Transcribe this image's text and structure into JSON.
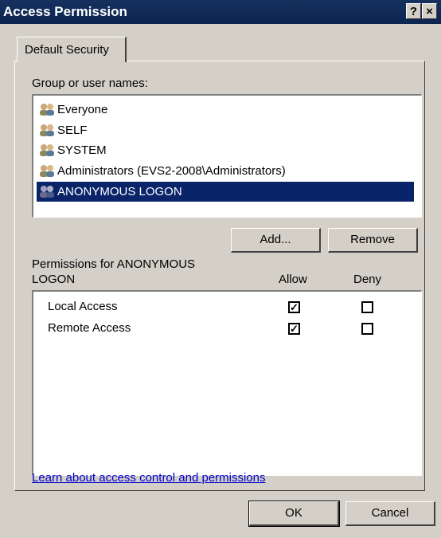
{
  "window": {
    "title": "Access Permission",
    "help_label": "?",
    "close_label": "×"
  },
  "tab": {
    "label": "Default Security"
  },
  "group": {
    "label": "Group or user names:",
    "users": [
      {
        "name": "Everyone",
        "selected": false
      },
      {
        "name": "SELF",
        "selected": false
      },
      {
        "name": "SYSTEM",
        "selected": false
      },
      {
        "name": "Administrators (EVS2-2008\\Administrators)",
        "selected": false
      },
      {
        "name": "ANONYMOUS LOGON",
        "selected": true
      }
    ]
  },
  "buttons": {
    "add": "Add...",
    "remove": "Remove",
    "ok": "OK",
    "cancel": "Cancel"
  },
  "permissions": {
    "label_line1": "Permissions for ANONYMOUS",
    "label_line2": "LOGON",
    "allow_header": "Allow",
    "deny_header": "Deny",
    "items": [
      {
        "name": "Local Access",
        "allow": true,
        "deny": false
      },
      {
        "name": "Remote Access",
        "allow": true,
        "deny": false
      }
    ]
  },
  "link": {
    "text": "Learn about access control and permissions"
  },
  "colors": {
    "titlebar": "#0c2450",
    "selection": "#0a246a",
    "link": "#0000d0"
  }
}
